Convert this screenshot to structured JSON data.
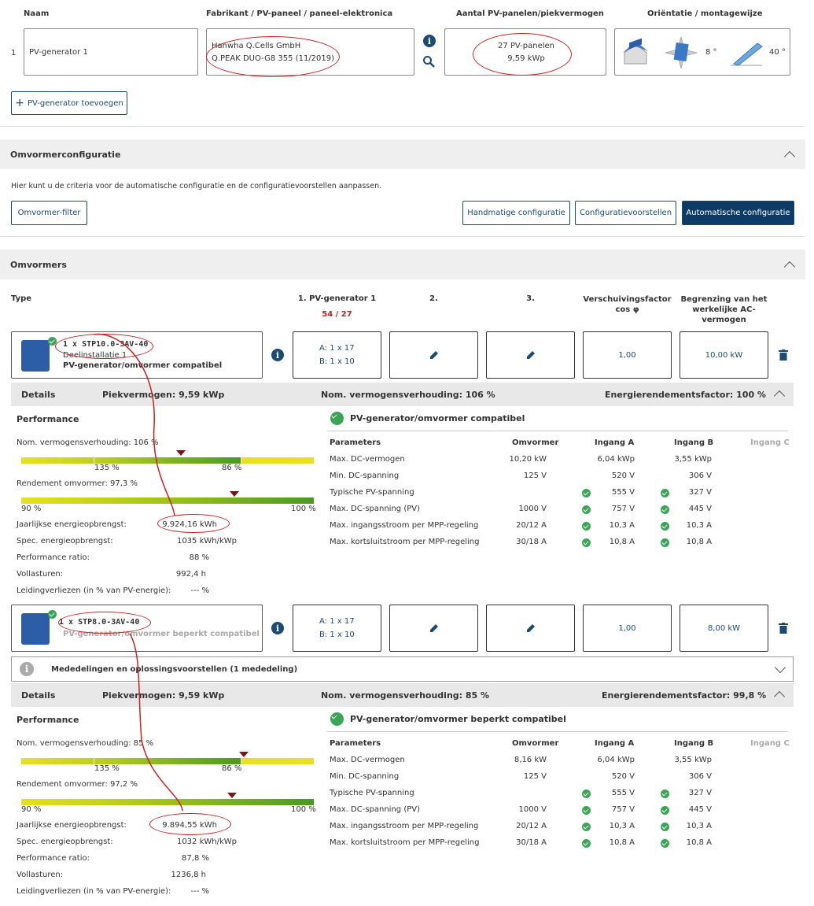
{
  "pv_table": {
    "headers": {
      "name": "Naam",
      "manufacturer": "Fabrikant / PV-paneel / paneel-elektronica",
      "count": "Aantal PV-panelen/piekvermogen",
      "orientation": "Oriëntatie / montagewijze"
    },
    "row_index": "1",
    "name": "PV-generator 1",
    "manufacturer": "Hanwha Q.Cells GmbH",
    "panel": "Q.PEAK DUO-G8 355 (11/2019)",
    "panels": "27 PV-panelen",
    "peak": "9,59 kWp",
    "azimuth": "8 °",
    "tilt": "40 °",
    "add_button": "PV-generator toevoegen"
  },
  "omvormer_config": {
    "title": "Omvormerconfiguratie",
    "description": "Hier kunt u de criteria voor de automatische configuratie en de configuratievoorstellen aanpassen.",
    "filter_button": "Omvormer-filter",
    "manual_button": "Handmatige configuratie",
    "proposals_button": "Configuratievoorstellen",
    "auto_button": "Automatische configuratie"
  },
  "omvormers": {
    "title": "Omvormers",
    "col_type": "Type",
    "col_gen1": "1. PV-generator 1",
    "col_gen1_count": "54 / 27",
    "col_2": "2.",
    "col_3": "3.",
    "col_cos": "Verschuivingsfactor cos φ",
    "col_limit": "Begrenzing van het werkelijke AC-vermogen",
    "inverters": [
      {
        "name": "1 x STP10.0-3AV-40",
        "sub": "Deelinstallatie 1",
        "status": "PV-generator/omvormer compatibel",
        "strings_a": "A: 1 x 17",
        "strings_b": "B: 1 x 10",
        "cos": "1,00",
        "limit": "10,00 kW",
        "details": {
          "label": "Details",
          "peak": "Piekvermogen: 9,59 kWp",
          "ratio": "Nom. vermogensverhouding: 106 %",
          "efficiency": "Energierendementsfactor: 100 %",
          "performance_title": "Performance",
          "nom_ratio_label": "Nom. vermogensverhouding: 106 %",
          "scale1_left": "135 %",
          "scale1_right": "86 %",
          "rendement_label": "Rendement omvormer: 97,3 %",
          "scale2_left": "90 %",
          "scale2_right": "100 %",
          "ratio_level": 106,
          "rendement_level": 97.3,
          "metrics": [
            {
              "label": "Jaarlijkse energieopbrengst:",
              "value": "9.924,16 kWh"
            },
            {
              "label": "Spec. energieopbrengst:",
              "value": "1035 kWh/kWp"
            },
            {
              "label": "Performance ratio:",
              "value": "88 %"
            },
            {
              "label": "Vollasturen:",
              "value": "992,4 h"
            },
            {
              "label": "Leidingverliezen (in % van PV-energie):",
              "value": "--- %"
            }
          ],
          "compat_title": "PV-generator/omvormer compatibel",
          "param_headers": [
            "Parameters",
            "Omvormer",
            "Ingang A",
            "Ingang B",
            "Ingang C"
          ],
          "params": [
            {
              "name": "Max. DC-vermogen",
              "inv": "10,20 kW",
              "a": "6,04 kWp",
              "b": "3,55 kWp",
              "check": false
            },
            {
              "name": "Min. DC-spanning",
              "inv": "125 V",
              "a": "520 V",
              "b": "306 V",
              "check": false
            },
            {
              "name": "Typische PV-spanning",
              "inv": "",
              "a": "555 V",
              "b": "327 V",
              "check": true
            },
            {
              "name": "Max. DC-spanning (PV)",
              "inv": "1000 V",
              "a": "757 V",
              "b": "445 V",
              "check": true
            },
            {
              "name": "Max. ingangsstroom per MPP-regeling",
              "inv": "20/12 A",
              "a": "10,3 A",
              "b": "10,3 A",
              "check": true
            },
            {
              "name": "Max. kortsluitstroom per MPP-regeling",
              "inv": "30/18 A",
              "a": "10,8 A",
              "b": "10,8 A",
              "check": true
            }
          ]
        }
      },
      {
        "name": "1 x STP8.0-3AV-40",
        "status": "PV-generator/omvormer beperkt compatibel",
        "strings_a": "A: 1 x 17",
        "strings_b": "B: 1 x 10",
        "cos": "1,00",
        "limit": "8,00 kW",
        "notice": "Mededelingen en oplossingsvoorstellen (1 mededeling)",
        "details": {
          "label": "Details",
          "peak": "Piekvermogen: 9,59 kWp",
          "ratio": "Nom. vermogensverhouding: 85 %",
          "efficiency": "Energierendementsfactor: 99,8 %",
          "performance_title": "Performance",
          "nom_ratio_label": "Nom. vermogensverhouding: 85 %",
          "scale1_left": "135 %",
          "scale1_right": "86 %",
          "rendement_label": "Rendement omvormer: 97,2 %",
          "scale2_left": "90 %",
          "scale2_right": "100 %",
          "ratio_level": 85,
          "rendement_level": 97.2,
          "metrics": [
            {
              "label": "Jaarlijkse energieopbrengst:",
              "value": "9.894,55 kWh"
            },
            {
              "label": "Spec. energieopbrengst:",
              "value": "1032 kWh/kWp"
            },
            {
              "label": "Performance ratio:",
              "value": "87,8 %"
            },
            {
              "label": "Vollasturen:",
              "value": "1236,8 h"
            },
            {
              "label": "Leidingverliezen (in % van PV-energie):",
              "value": "--- %"
            }
          ],
          "compat_title": "PV-generator/omvormer beperkt compatibel",
          "param_headers": [
            "Parameters",
            "Omvormer",
            "Ingang A",
            "Ingang B",
            "Ingang C"
          ],
          "params": [
            {
              "name": "Max. DC-vermogen",
              "inv": "8,16 kW",
              "a": "6,04 kWp",
              "b": "3,55 kWp",
              "check": false
            },
            {
              "name": "Min. DC-spanning",
              "inv": "125 V",
              "a": "520 V",
              "b": "306 V",
              "check": false
            },
            {
              "name": "Typische PV-spanning",
              "inv": "",
              "a": "555 V",
              "b": "327 V",
              "check": true
            },
            {
              "name": "Max. DC-spanning (PV)",
              "inv": "1000 V",
              "a": "757 V",
              "b": "445 V",
              "check": true
            },
            {
              "name": "Max. ingangsstroom per MPP-regeling",
              "inv": "20/12 A",
              "a": "10,3 A",
              "b": "10,3 A",
              "check": true
            },
            {
              "name": "Max. kortsluitstroom per MPP-regeling",
              "inv": "30/18 A",
              "a": "10,8 A",
              "b": "10,8 A",
              "check": true
            }
          ]
        }
      }
    ]
  },
  "colors": {
    "brand": "#0e3a66",
    "check": "#3aa655",
    "marker": "#7a1515",
    "red_annotation": "#c22222"
  }
}
